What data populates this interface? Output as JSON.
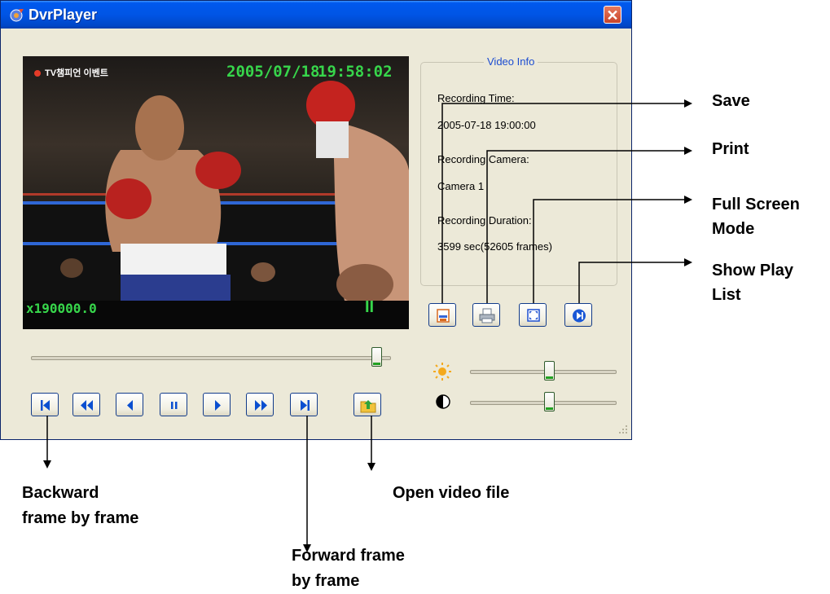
{
  "window": {
    "title": "DvrPlayer",
    "close_glyph": "✕"
  },
  "video": {
    "channel_label": "TV챔피언 이벤트",
    "date": "2005/07/18",
    "time": "19:58:02",
    "speed": "x190000.0",
    "state_glyph": "II"
  },
  "video_info": {
    "legend": "Video Info",
    "recording_time_label": "Recording Time:",
    "recording_time_value": "2005-07-18 19:00:00",
    "recording_camera_label": "Recording Camera:",
    "recording_camera_value": "Camera 1",
    "recording_duration_label": "Recording Duration:",
    "recording_duration_value": "3599 sec(52605 frames)"
  },
  "tool_buttons": [
    {
      "name": "save",
      "icon": "save-icon"
    },
    {
      "name": "print",
      "icon": "print-icon"
    },
    {
      "name": "full-screen",
      "icon": "fullscreen-icon"
    },
    {
      "name": "play-list",
      "icon": "playlist-icon"
    }
  ],
  "transport_buttons": [
    {
      "name": "first-frame",
      "icon": "skip-to-start-icon"
    },
    {
      "name": "rewind",
      "icon": "fast-backward-icon"
    },
    {
      "name": "backward-frame",
      "icon": "step-backward-icon"
    },
    {
      "name": "pause",
      "icon": "pause-icon"
    },
    {
      "name": "play",
      "icon": "play-icon"
    },
    {
      "name": "fast-forward",
      "icon": "fast-forward-icon"
    },
    {
      "name": "forward-frame",
      "icon": "step-forward-icon"
    },
    {
      "name": "open-file",
      "icon": "open-folder-icon"
    }
  ],
  "sliders": {
    "position": 0.98,
    "brightness": 0.55,
    "contrast": 0.55
  },
  "annotations": {
    "save": "Save",
    "print": "Print",
    "full_screen_1": "Full Screen",
    "full_screen_2": "Mode",
    "play_list_1": "Show Play",
    "play_list_2": "List",
    "backward_1": "Backward",
    "backward_2": "frame by frame",
    "open_video": "Open video file",
    "forward_1": "Forward frame",
    "forward_2": "by frame"
  },
  "colors": {
    "titlebar": "#0055e5",
    "window_bg": "#ece9d8",
    "overlay_text": "#37d64b",
    "legend_text": "#1b4cd1",
    "button_icon": "#0b4fd0"
  }
}
